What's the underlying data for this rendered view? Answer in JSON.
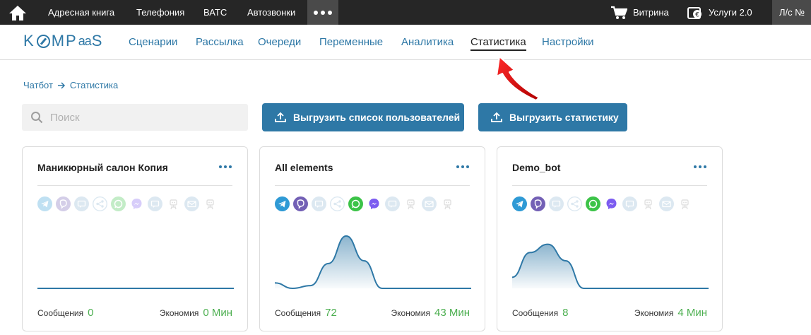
{
  "topbar": {
    "links": [
      "Адресная книга",
      "Телефония",
      "ВАТС",
      "Автозвонки"
    ],
    "showcase_label": "Витрина",
    "services_label": "Услуги 2.0",
    "account_label": "Л/с №"
  },
  "nav": {
    "logo_k": "K",
    "logo_mp": "MP",
    "logo_aa": "aa",
    "logo_s": "S",
    "items": [
      "Сценарии",
      "Рассылка",
      "Очереди",
      "Переменные",
      "Аналитика",
      "Статистика",
      "Настройки"
    ],
    "active": "Статистика"
  },
  "breadcrumb": {
    "parent": "Чатбот",
    "current": "Статистика"
  },
  "search": {
    "placeholder": "Поиск",
    "value": ""
  },
  "buttons": {
    "export_users": "Выгрузить список пользователей",
    "export_stats": "Выгрузить статистику"
  },
  "channel_colors": [
    "#2f9ad5",
    "#7360b5",
    "#8fb5d3",
    "#8fb5d3",
    "#3cc348",
    "#7c5cf0",
    "#8fb5d3",
    "#9a9a9a",
    "#8fb5d3",
    "#9a9a9a"
  ],
  "channel_icons": [
    "telegram-icon",
    "viber-icon",
    "chat-icon",
    "share-icon",
    "whatsapp-icon",
    "messenger-icon",
    "sms-icon",
    "robot-icon",
    "email-icon",
    "robot-icon"
  ],
  "cards": [
    {
      "title": "Маникюрный салон Копия",
      "messages_label": "Сообщения",
      "messages_value": "0",
      "economy_label": "Экономия",
      "economy_value": "0 Мин",
      "channels_active": [
        false,
        false,
        false,
        false,
        false,
        false,
        false,
        false,
        false,
        false
      ],
      "curve": [
        0,
        0,
        0,
        0,
        0,
        0,
        0,
        0,
        0,
        0,
        0,
        0
      ]
    },
    {
      "title": "All elements",
      "messages_label": "Сообщения",
      "messages_value": "72",
      "economy_label": "Экономия",
      "economy_value": "43 Мин",
      "channels_active": [
        true,
        true,
        false,
        false,
        true,
        true,
        false,
        false,
        false,
        false
      ],
      "curve": [
        0.1,
        0.0,
        0.05,
        0.45,
        0.95,
        0.5,
        0.0,
        0.0,
        0.0,
        0.0,
        0.0,
        0.0
      ]
    },
    {
      "title": "Demo_bot",
      "messages_label": "Сообщения",
      "messages_value": "8",
      "economy_label": "Экономия",
      "economy_value": "4 Мин",
      "channels_active": [
        true,
        true,
        false,
        false,
        true,
        true,
        false,
        false,
        false,
        false
      ],
      "curve": [
        0.2,
        0.65,
        0.8,
        0.5,
        0.0,
        0.0,
        0.0,
        0.0,
        0.0,
        0.0,
        0.0,
        0.0
      ]
    }
  ]
}
